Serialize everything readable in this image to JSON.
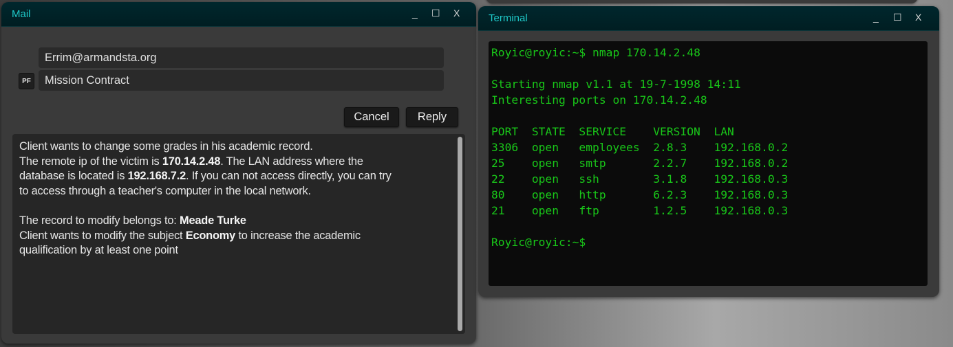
{
  "mail": {
    "title": "Mail",
    "controls": {
      "minimize": "_",
      "maximize": "☐",
      "close": "X"
    },
    "to": "Errim@armandsta.org",
    "subject": "Mission Contract",
    "pf_label": "PF",
    "cancel_label": "Cancel",
    "reply_label": "Reply",
    "body_lines": [
      [
        {
          "t": "Client wants to change some grades in his academic record."
        }
      ],
      [
        {
          "t": "The remote ip of the victim is "
        },
        {
          "t": "170.14.2.48",
          "b": true
        },
        {
          "t": ". The LAN address where the"
        }
      ],
      [
        {
          "t": "database is located is "
        },
        {
          "t": "192.168.7.2",
          "b": true
        },
        {
          "t": ". If you can not access directly, you can try"
        }
      ],
      [
        {
          "t": "to access through a teacher's computer in the local network."
        }
      ],
      [],
      [
        {
          "t": "The record to modify belongs to: "
        },
        {
          "t": "Meade Turke",
          "b": true
        }
      ],
      [
        {
          "t": "Client wants to modify the subject "
        },
        {
          "t": "Economy",
          "b": true
        },
        {
          "t": " to increase the academic"
        }
      ],
      [
        {
          "t": "qualification by at least one point"
        }
      ]
    ]
  },
  "terminal": {
    "title": "Terminal",
    "controls": {
      "minimize": "_",
      "maximize": "☐",
      "close": "X"
    },
    "command_line": "Royic@royic:~$ nmap 170.14.2.48",
    "starting": "Starting nmap v1.1 at 19-7-1998 14:11",
    "interesting": "Interesting ports on 170.14.2.48",
    "columns": [
      "PORT",
      "STATE",
      "SERVICE",
      "VERSION",
      "LAN"
    ],
    "rows": [
      [
        "3306",
        "open",
        "employees",
        "2.8.3",
        "192.168.0.2"
      ],
      [
        "25",
        "open",
        "smtp",
        "2.2.7",
        "192.168.0.2"
      ],
      [
        "22",
        "open",
        "ssh",
        "3.1.8",
        "192.168.0.3"
      ],
      [
        "80",
        "open",
        "http",
        "6.2.3",
        "192.168.0.3"
      ],
      [
        "21",
        "open",
        "ftp",
        "1.2.5",
        "192.168.0.3"
      ]
    ],
    "prompt": "Royic@royic:~$",
    "text_color": "#19c719"
  }
}
